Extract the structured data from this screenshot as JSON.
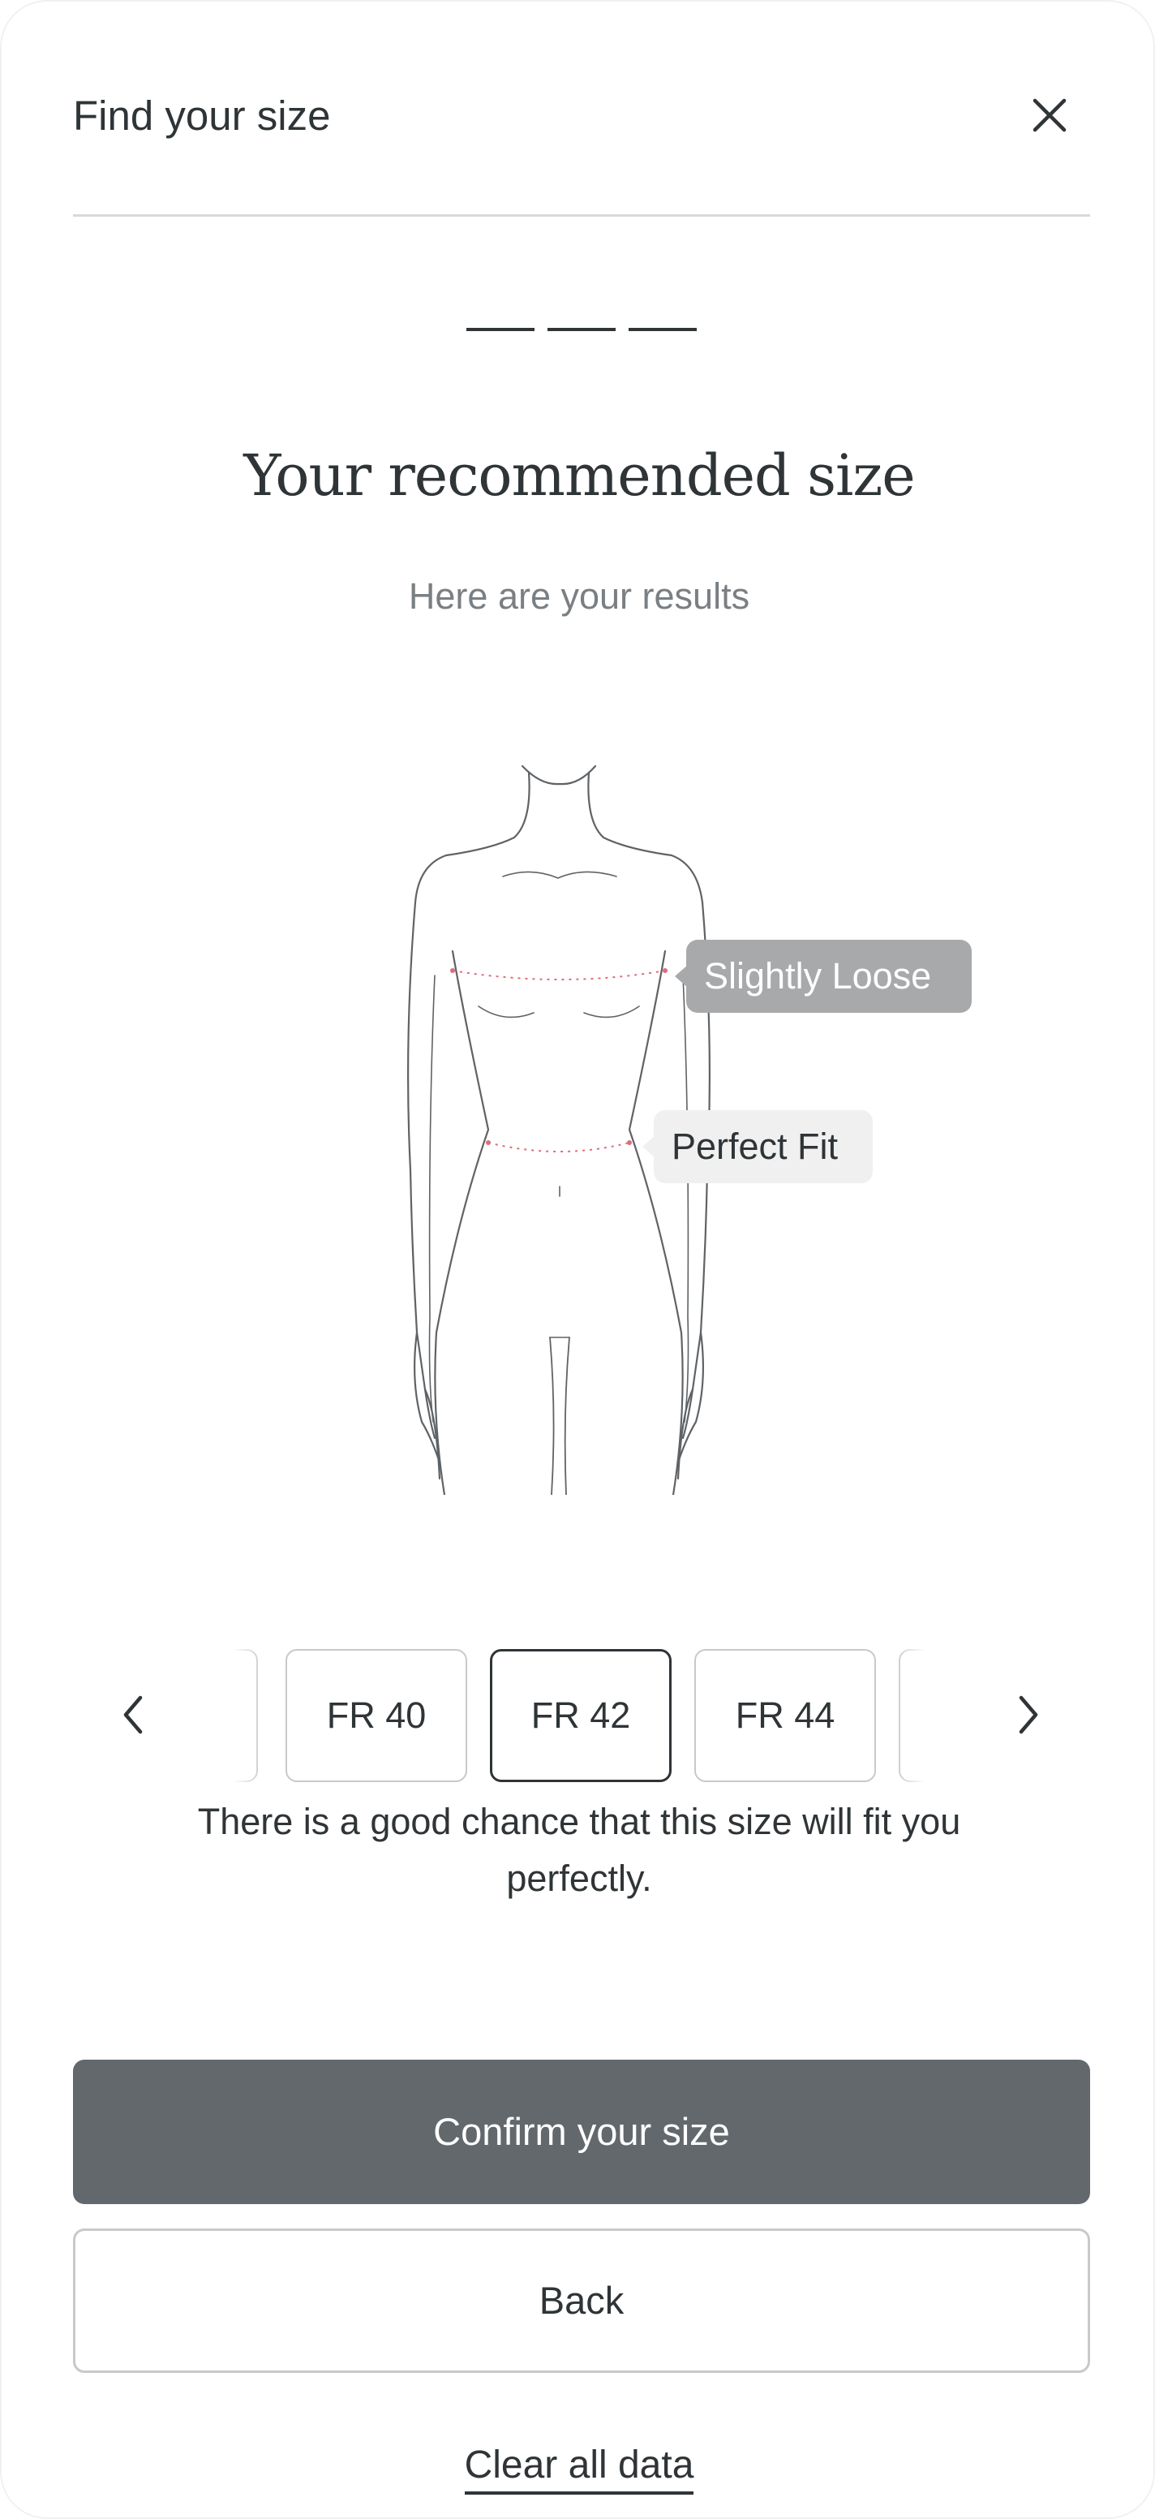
{
  "header": {
    "title": "Find your size",
    "close_icon": "close-icon"
  },
  "progress": {
    "total_steps": 3,
    "completed_steps": 3
  },
  "result": {
    "title": "Your recommended size",
    "subtitle": "Here are your results",
    "fit_labels": {
      "chest": "Slightly Loose",
      "waist": "Perfect Fit"
    },
    "message": "There is a good chance that this size will fit you perfectly."
  },
  "size_selector": {
    "prev_icon": "chevron-left-icon",
    "next_icon": "chevron-right-icon",
    "options": [
      "FR 40",
      "FR 42",
      "FR 44"
    ],
    "selected": "FR 42"
  },
  "actions": {
    "confirm_label": "Confirm your size",
    "back_label": "Back",
    "clear_label": "Clear all data"
  },
  "colors": {
    "text": "#2f3437",
    "muted_text": "#7a7f83",
    "primary_button": "#62686c",
    "loose_tag": "#a7a9ab",
    "perfect_tag": "#f0f0f0",
    "measure_line": "#e06c7c"
  }
}
